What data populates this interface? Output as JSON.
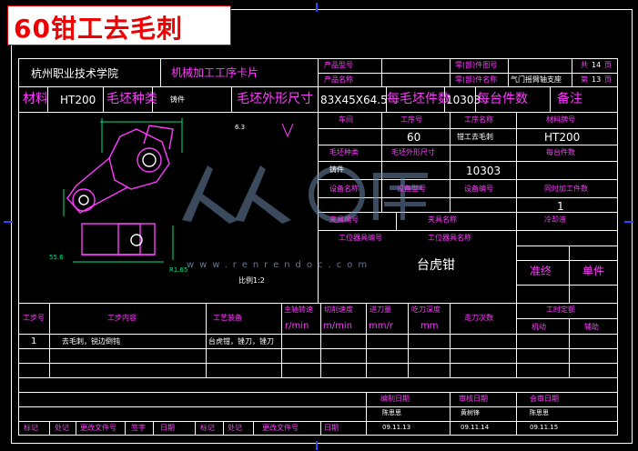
{
  "banner": {
    "title": "60钳工去毛刺"
  },
  "header": {
    "school": "杭州职业技术学院",
    "card_title": "机械加工工序卡片",
    "product_model_label": "产品型号",
    "part_drawing_no_label": "零(部)件图号",
    "total_label": "共",
    "total_value": "14",
    "total_unit": "页",
    "product_name_label": "产品名称",
    "part_name_label": "零(部)件名称",
    "part_name_value": "气门摇臂轴支座",
    "page_label": "第",
    "page_value": "13",
    "page_unit": "页"
  },
  "material_row": {
    "material_label": "材料",
    "material_value": "HT200",
    "blank_type_label": "毛坯种类",
    "blank_type_value": "铸件",
    "blank_size_label": "毛坯外形尺寸",
    "blank_size_value": "83X45X64.5",
    "blank_count_label": "每毛坯件数",
    "blank_count_value": "10303",
    "per_unit_label": "每台件数",
    "remarks_label": "备注"
  },
  "process_info": {
    "workshop_label": "车间",
    "op_no_label": "工序号",
    "op_name_label": "工序名称",
    "material_grade_label": "材料牌号",
    "op_no_value": "60",
    "op_name_value": "钳工去毛刺",
    "material_grade_value": "HT200",
    "blank_type_label": "毛坯种类",
    "blank_size_label": "毛坯外形尺寸",
    "per_unit_label": "每台件数",
    "blank_type_value": "铸件",
    "blank_count_value": "10303",
    "equipment_name_label": "设备名称",
    "equipment_model_label": "设备型号",
    "equipment_no_label": "设备编号",
    "simul_parts_label": "同时加工件数",
    "simul_parts_value": "1",
    "fixture_no_label": "夹具编号",
    "fixture_name_label": "夹具名称",
    "coolant_label": "冷却液",
    "fixture_name_value": "台虎钳",
    "station_tool_no_label": "工位器具编号",
    "station_tool_name_label": "工位器具名称",
    "prep_label": "准终",
    "unit_label": "单件"
  },
  "drawing": {
    "scale_label": "比例1:2",
    "roughness_label": "6.3",
    "dim_a": "55.6",
    "dim_b": "R1.65"
  },
  "steps_table": {
    "headers": {
      "step_no": "工步号",
      "step_content": "工步内容",
      "equipment": "工艺装备",
      "spindle_speed": "主轴转速",
      "spindle_unit": "r/min",
      "cut_speed": "切削速度",
      "cut_unit": "m/min",
      "feed": "进刀量",
      "feed_unit": "mm/r",
      "depth": "吃刀深度",
      "depth_unit": "mm",
      "passes": "走刀次数",
      "time_quota": "工时定额",
      "machine_time": "机动",
      "aux_time": "辅助"
    },
    "rows": [
      {
        "no": "1",
        "content": "去毛刺，锐边倒钝",
        "equipment": "台虎钳，锉刀，锉刀"
      }
    ]
  },
  "signoff": {
    "compile_date_label": "编制日期",
    "review_date_label": "审核日期",
    "countersign_date_label": "会审日期",
    "compile_name": "陈思思",
    "review_name": "黄树锋",
    "countersign_name": "陈思思",
    "compile_date": "09.11.13",
    "review_date": "09.11.14",
    "countersign_date": "09.11.15"
  },
  "footer": {
    "mark": "标记",
    "count": "处记",
    "change_doc": "更改文件号",
    "sign": "签字",
    "date": "日期",
    "mark2": "标记",
    "count2": "处记",
    "change_doc2": "更改文件号",
    "date2": "日期"
  },
  "watermark": {
    "text": "www.renrendoc.com"
  },
  "colors": {
    "background": "#000000",
    "line": "#ffffff",
    "label": "#ff3cff",
    "title_red": "#e00000",
    "frame_tick": "#3344ff"
  }
}
